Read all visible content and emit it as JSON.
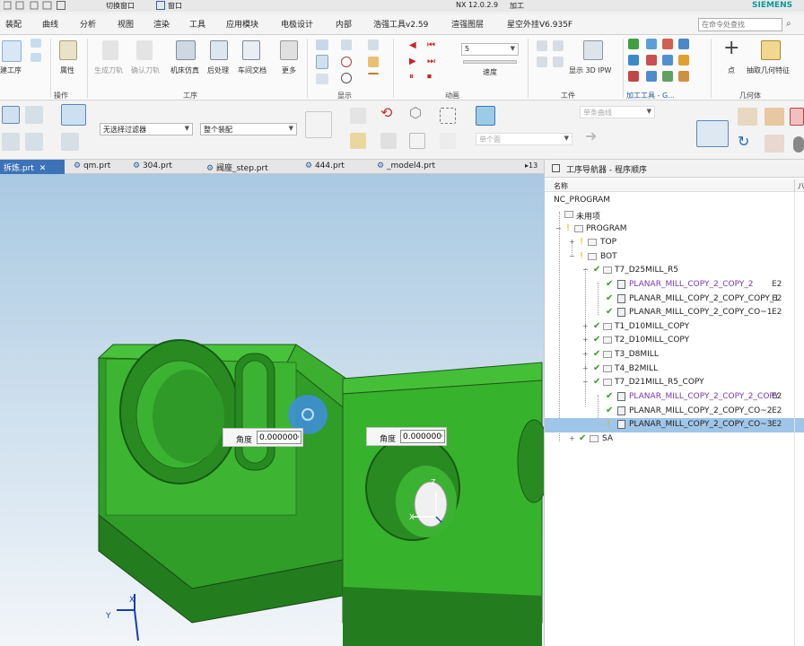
{
  "titlebar": {
    "app_title": "NX 12.0.2.9",
    "module": "加工",
    "switch_window": "切换窗口",
    "window": "窗口",
    "brand": "SIEMENS"
  },
  "menubar": {
    "items": [
      "装配",
      "曲线",
      "分析",
      "视图",
      "渲染",
      "工具",
      "应用模块",
      "电极设计",
      "内部",
      "浩强工具v2.59",
      "渲强图层",
      "星空外挂V6.935F"
    ],
    "search_placeholder": "在命令处查找"
  },
  "ribbon": {
    "create_op": "建工序",
    "properties": "属性",
    "sim_tool": "生成刀轨",
    "verify_tool": "确认刀轨",
    "machine_sim": "机床仿真",
    "postprocess": "后处理",
    "shop_doc": "车间文档",
    "more": "更多",
    "speed_label": "速度",
    "speed_value": "5",
    "show_3d_ipw": "显示 3D IPW",
    "point": "点",
    "extract_geom": "抽取几何特征",
    "groups": {
      "operation": "操作",
      "process": "工序",
      "display": "显示",
      "animation": "动画",
      "workpiece": "工件",
      "mfg_tools": "加工工具 - G...",
      "geometry": "几何体"
    }
  },
  "selectionbar": {
    "filter_value": "无选择过滤器",
    "scope_value": "整个装配",
    "curve_rule": "单条曲线",
    "face_rule": "单个面"
  },
  "tabs": [
    {
      "label": "拆炼.prt",
      "active": true
    },
    {
      "label": "qm.prt",
      "active": false
    },
    {
      "label": "304.prt",
      "active": false
    },
    {
      "label": "阀座_step.prt",
      "active": false
    },
    {
      "label": "444.prt",
      "active": false
    },
    {
      "label": "_model4.prt",
      "active": false
    }
  ],
  "tabs_overflow": "▸13",
  "viewport": {
    "angle_label": "角度",
    "angle_value": "0.0000000",
    "depth_label": "角度",
    "depth_value": "0.0000000",
    "axis_x": "X",
    "axis_y": "Y",
    "axis_z": "Z"
  },
  "navigator": {
    "title": "工序导航器 - 程序顺序",
    "col_name": "名称",
    "col_right": "八",
    "rows": [
      {
        "label": "NC_PROGRAM",
        "value": ""
      },
      {
        "label": "未用项",
        "value": ""
      },
      {
        "label": "PROGRAM",
        "value": ""
      },
      {
        "label": "TOP",
        "value": ""
      },
      {
        "label": "BOT",
        "value": ""
      },
      {
        "label": "T7_D25MILL_R5",
        "value": ""
      },
      {
        "label": "PLANAR_MILL_COPY_2_COPY_2",
        "value": "E2"
      },
      {
        "label": "PLANAR_MILL_COPY_2_COPY_COPY_1",
        "value": "E2"
      },
      {
        "label": "PLANAR_MILL_COPY_2_COPY_CO~1",
        "value": "E2"
      },
      {
        "label": "T1_D10MILL_COPY",
        "value": ""
      },
      {
        "label": "T2_D10MILL_COPY",
        "value": ""
      },
      {
        "label": "T3_D8MILL",
        "value": ""
      },
      {
        "label": "T4_B2MILL",
        "value": ""
      },
      {
        "label": "T7_D21MILL_R5_COPY",
        "value": ""
      },
      {
        "label": "PLANAR_MILL_COPY_2_COPY_2_COPY",
        "value": "E2"
      },
      {
        "label": "PLANAR_MILL_COPY_2_COPY_CO~2",
        "value": "E2"
      },
      {
        "label": "PLANAR_MILL_COPY_2_COPY_CO~3",
        "value": "E2"
      },
      {
        "label": "SA",
        "value": ""
      }
    ]
  },
  "colors": {
    "accent": "#3c73b8",
    "model_green": "#36a82e",
    "check_green": "#3a9a2a",
    "selection": "#9fc6e8"
  }
}
